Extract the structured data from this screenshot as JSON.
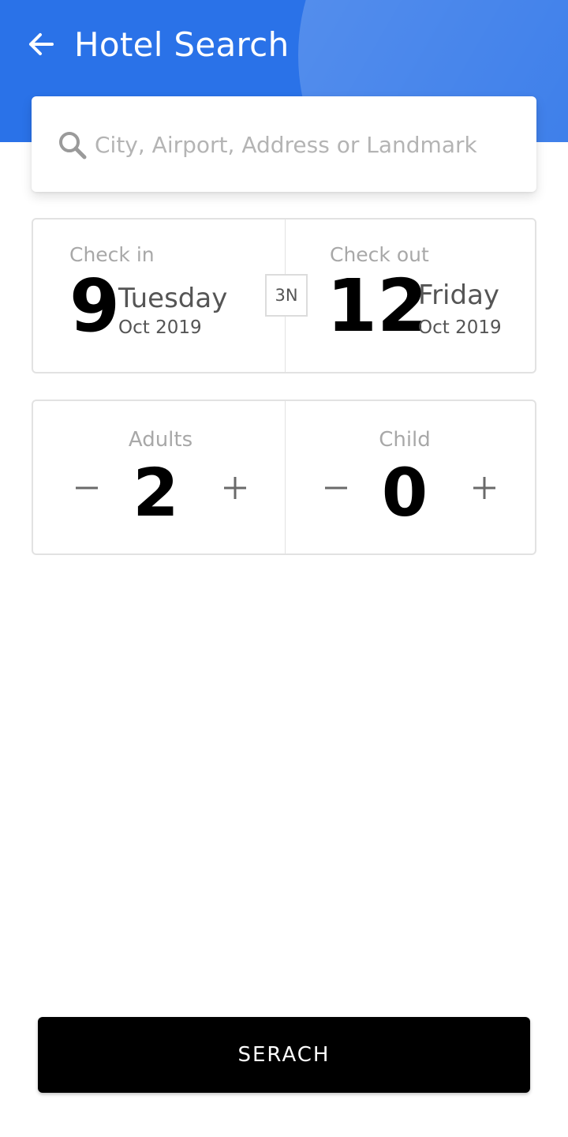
{
  "header": {
    "title": "Hotel Search",
    "background_color": "#2a72e8"
  },
  "search": {
    "placeholder": "City, Airport, Address or Landmark",
    "value": ""
  },
  "dates": {
    "check_in": {
      "label": "Check in",
      "day": "9",
      "weekday": "Tuesday",
      "month_year": "Oct 2019"
    },
    "check_out": {
      "label": "Check out",
      "day": "12",
      "weekday": "Friday",
      "month_year": "Oct 2019"
    },
    "nights": "3N"
  },
  "guests": {
    "adults": {
      "label": "Adults",
      "count": "2",
      "decrement": "−",
      "increment": "+"
    },
    "child": {
      "label": "Child",
      "count": "0",
      "decrement": "−",
      "increment": "+"
    }
  },
  "submit": {
    "label": "SERACH"
  },
  "icons": {
    "back": "arrow-left-icon",
    "search": "search-icon",
    "minus": "minus-icon",
    "plus": "plus-icon"
  }
}
